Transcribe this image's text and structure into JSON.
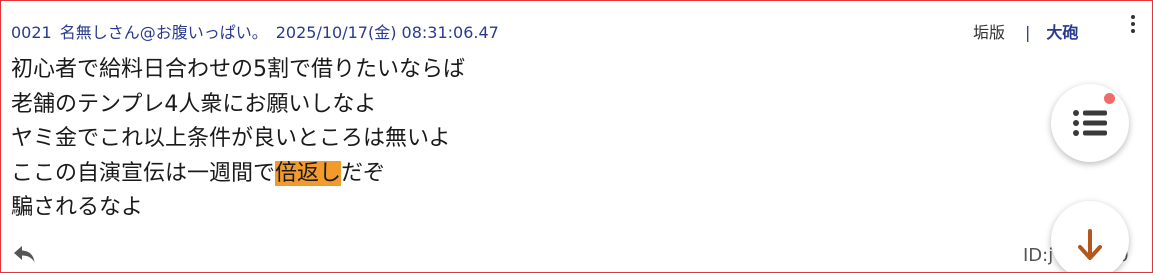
{
  "post": {
    "number": "0021",
    "name": "名無しさん@お腹いっぱい。",
    "datetime": "2025/10/17(金) 08:31:06.47",
    "id_label": "ID:j",
    "id_tail": "0"
  },
  "header_links": {
    "aka": "垢版",
    "separator": "|",
    "taihou": "大砲"
  },
  "body": {
    "line1": "初心者で給料日合わせの5割で借りたいならば",
    "line2": "老舗のテンプレ4人衆にお願いしなよ",
    "line3": "ヤミ金でこれ以上条件が良いところは無いよ",
    "line4_pre": "ここの自演宣伝は一週間で",
    "line4_highlight": "倍返し",
    "line4_post": "だぞ",
    "line5": "騙されるなよ"
  },
  "colors": {
    "frame_border": "#e3343c",
    "header_text": "#2a3b8f",
    "highlight": "#f39a2d",
    "notification_dot": "#f26b6b",
    "down_arrow": "#b5561c"
  },
  "icons": {
    "menu": "kebab-menu-icon",
    "reply": "reply-icon",
    "list": "list-icon",
    "down": "arrow-down-icon"
  }
}
